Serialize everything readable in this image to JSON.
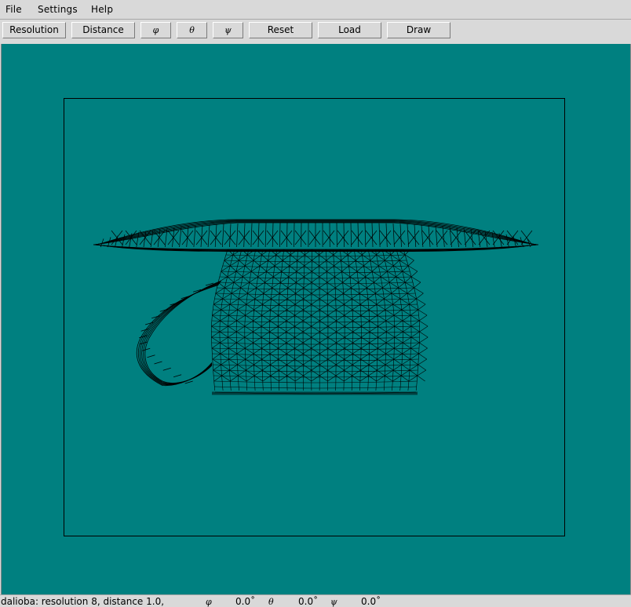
{
  "menu": {
    "file": "File",
    "settings": "Settings",
    "help": "Help"
  },
  "toolbar": {
    "resolution": "Resolution",
    "distance": "Distance",
    "phi": "φ",
    "theta": "θ",
    "psi": "ψ",
    "reset": "Reset",
    "load": "Load",
    "draw": "Draw"
  },
  "status": {
    "text": "dalioba: resolution 8, distance 1.0,",
    "phi_symbol": "φ",
    "phi_value": "0.0˚",
    "theta_symbol": "θ",
    "theta_value": "0.0˚",
    "psi_symbol": "ψ",
    "psi_value": "0.0˚"
  },
  "colors": {
    "canvas_background": "#008080",
    "wireframe": "#000000"
  }
}
